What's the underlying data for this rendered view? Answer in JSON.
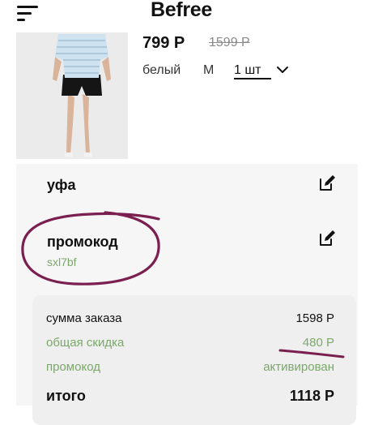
{
  "header": {
    "brand": "Befree"
  },
  "product": {
    "price": "799 Р",
    "old_price": "1599 Р",
    "color": "белый",
    "size": "M",
    "quantity": "1 шт"
  },
  "city": {
    "label": "уфа"
  },
  "promo": {
    "label": "промокод",
    "code": "sxl7bf"
  },
  "summary": {
    "order_sum_label": "сумма заказа",
    "order_sum_value": "1598 Р",
    "discount_label": "общая скидка",
    "discount_value": "480 Р",
    "promo_label": "промокод",
    "promo_status": "активирован",
    "total_label": "итого",
    "total_value": "1118 Р"
  },
  "colors": {
    "accent_green": "#7ba86a",
    "annotation": "#7a1f4f"
  }
}
